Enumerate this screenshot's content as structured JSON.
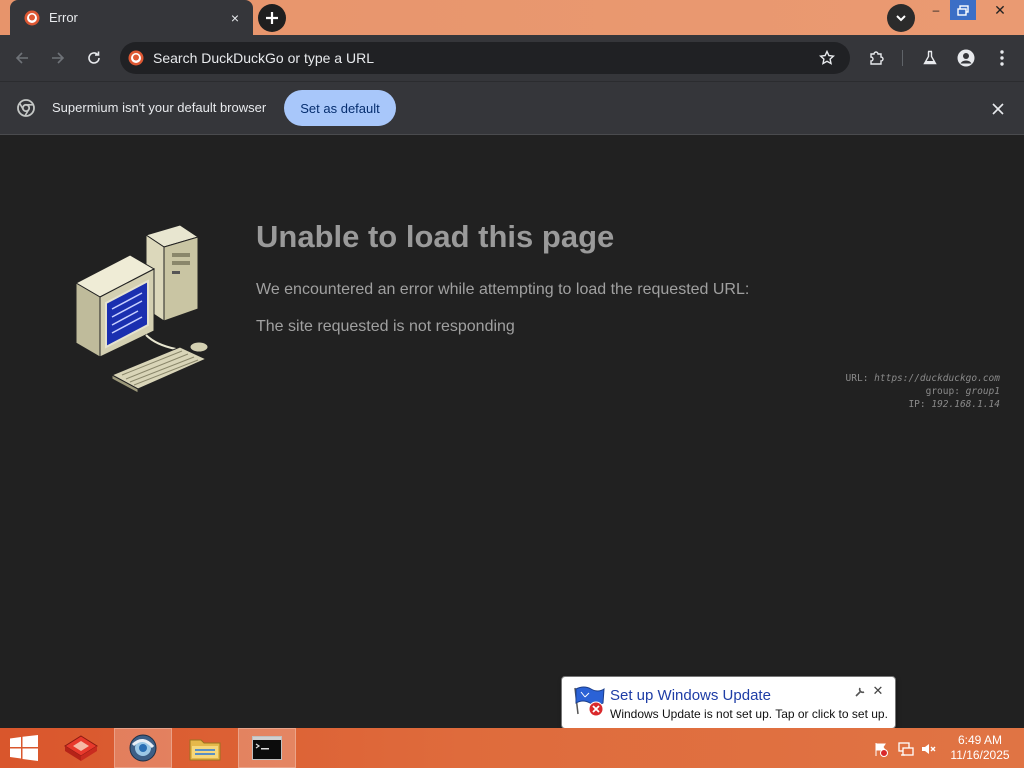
{
  "tab": {
    "title": "Error",
    "close_label": "×"
  },
  "window_controls": {
    "minimize": "–",
    "close": "✕"
  },
  "omnibox": {
    "placeholder": "Search DuckDuckGo or type a URL"
  },
  "infobar": {
    "message": "Supermium isn't your default browser",
    "button_label": "Set as default"
  },
  "error_page": {
    "title": "Unable to load this page",
    "line1": "We encountered an error while attempting to load the requested URL:",
    "line2": "The site requested is not responding",
    "meta": {
      "url_key": "URL:",
      "url_value": "https://duckduckgo.com",
      "group_key": "group:",
      "group_value": "group1",
      "ip_key": "IP:",
      "ip_value": "192.168.1.14"
    }
  },
  "notification": {
    "title": "Set up Windows Update",
    "text": "Windows Update is not set up. Tap or click to set up."
  },
  "taskbar": {
    "apps": [
      "start",
      "app-red",
      "browser",
      "file-explorer",
      "command-prompt"
    ],
    "clock_time": "6:49 AM",
    "clock_date": "11/16/2025"
  },
  "colors": {
    "accent_blue": "#a8c7fa",
    "tabstrip": "#ea9a72",
    "taskbar": "#df6b3c",
    "content_bg": "#212121"
  },
  "icons": [
    "duckduckgo-icon",
    "back-arrow-icon",
    "forward-arrow-icon",
    "reload-icon",
    "star-icon",
    "extensions-icon",
    "labs-flask-icon",
    "profile-icon",
    "kebab-menu-icon",
    "supermium-icon",
    "close-icon",
    "retro-computer-icon",
    "windows-flag-icon"
  ]
}
